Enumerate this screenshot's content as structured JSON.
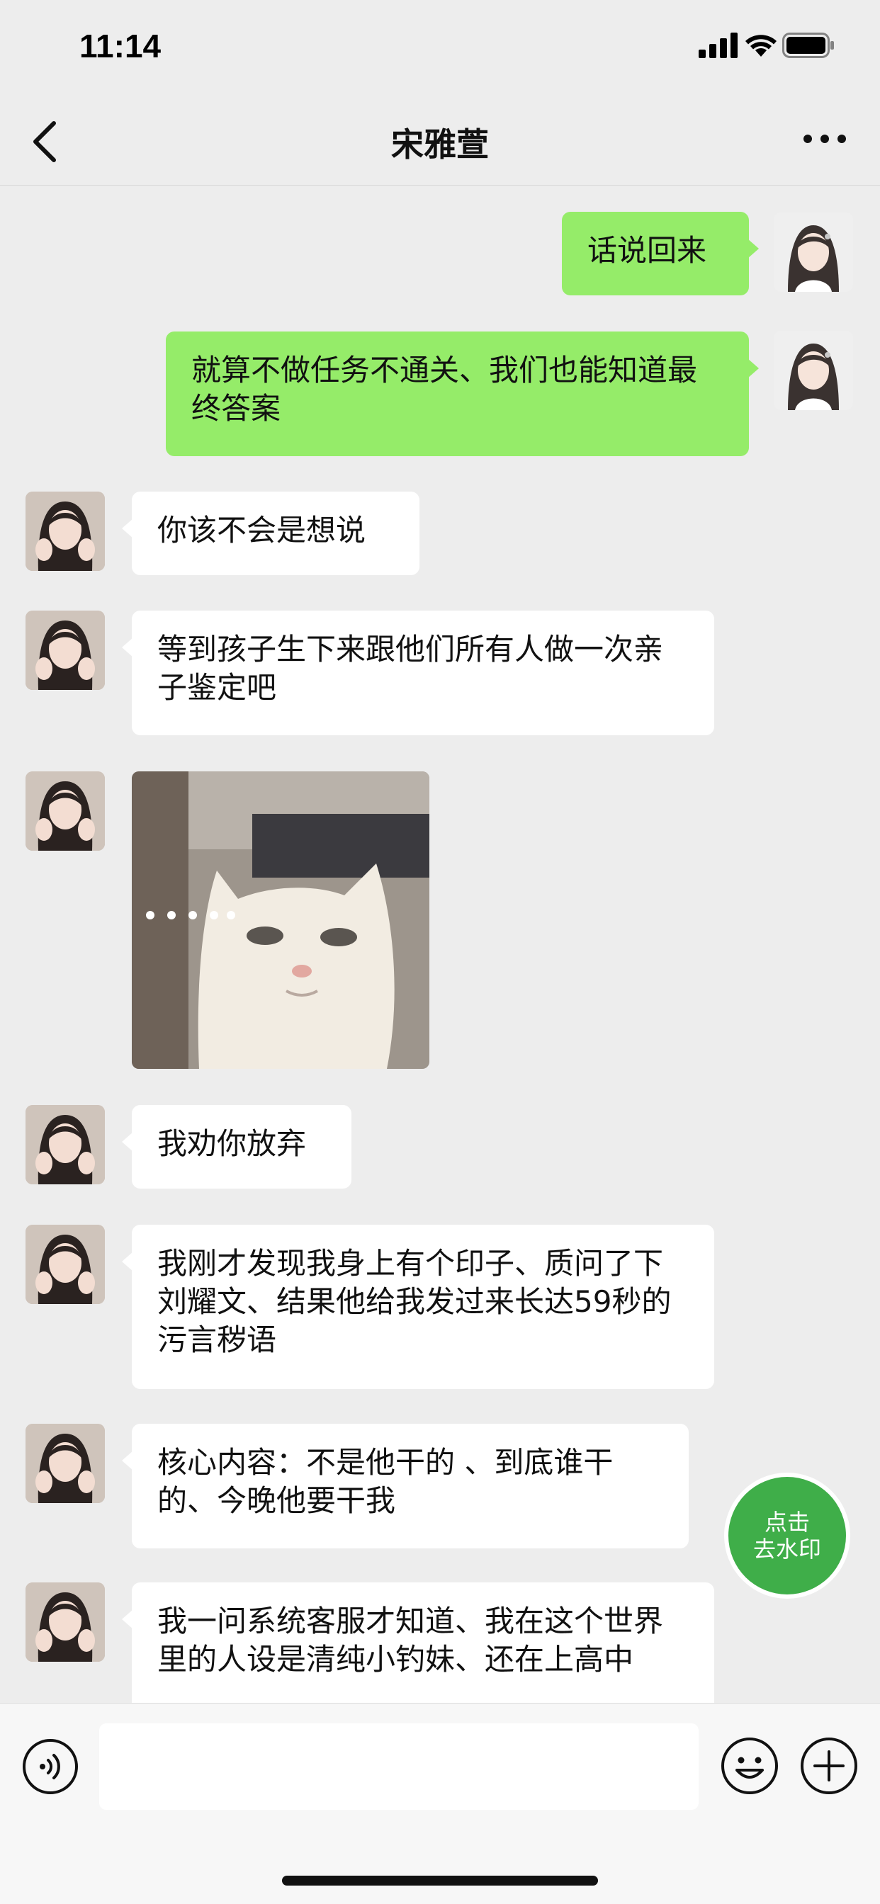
{
  "status_bar": {
    "time": "11:14"
  },
  "header": {
    "title": "宋雅萱"
  },
  "messages": [
    {
      "side": "out",
      "text": "话说回来"
    },
    {
      "side": "out",
      "text": "就算不做任务不通关、我们也能知道最终答案"
    },
    {
      "side": "in",
      "text": "你该不会是想说"
    },
    {
      "side": "in",
      "text": "等到孩子生下来跟他们所有人做一次亲子鉴定吧"
    },
    {
      "side": "in",
      "type": "sticker"
    },
    {
      "side": "in",
      "text": "我劝你放弃"
    },
    {
      "side": "in",
      "text": "我刚才发现我身上有个印子、质问了下刘耀文、结果他给我发过来长达59秒的污言秽语"
    },
    {
      "side": "in",
      "text": "核心内容：不是他干的 、到底谁干的、今晚他要干我"
    },
    {
      "side": "in",
      "text": "我一问系统客服才知道、我在这个世界里的人设是清纯小钓妹、还在上高中"
    }
  ],
  "float_button": {
    "line1": "点击",
    "line2": "去水印",
    "color": "#3fae49"
  },
  "colors": {
    "outgoing_bubble": "#95ec69",
    "incoming_bubble": "#ffffff",
    "background": "#ededed"
  },
  "icons": {
    "back": "chevron-left-icon",
    "more": "ellipsis-icon",
    "voice": "voice-icon",
    "emoji": "emoji-icon",
    "plus": "plus-circle-icon"
  }
}
